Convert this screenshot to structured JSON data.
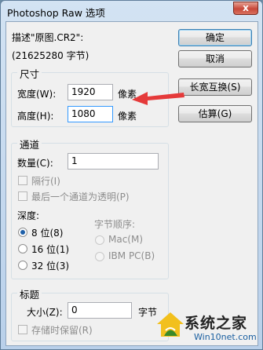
{
  "window": {
    "title": "Photoshop Raw 选项",
    "close_glyph": "x"
  },
  "description": {
    "label": "描述\"原图.CR2\":",
    "bytes": "(21625280 字节)"
  },
  "size_group": {
    "title": "尺寸",
    "width_label": "宽度(W):",
    "width_value": "1920",
    "width_unit": "像素",
    "height_label": "高度(H):",
    "height_value": "1080",
    "height_unit": "像素"
  },
  "buttons": {
    "ok": "确定",
    "cancel": "取消",
    "swap": "长宽互换(S)",
    "guess": "估算(G)"
  },
  "channels_group": {
    "title": "通道",
    "count_label": "数量(C):",
    "count_value": "1",
    "interleaved_label": "隔行(I)",
    "last_transparent_label": "最后一个通道为透明(P)",
    "depth_label": "深度:",
    "depth_options": [
      "8 位(8)",
      "16 位(1)",
      "32 位(3)"
    ],
    "byte_order_label": "字节顺序:",
    "byte_order_options": [
      "Mac(M)",
      "IBM PC(B)"
    ]
  },
  "header_group": {
    "title": "标题",
    "size_label": "大小(Z):",
    "size_value": "0",
    "size_unit": "字节",
    "keep_label": "存储时保留(R)"
  },
  "watermark": {
    "brand": "系统之家",
    "site": "Win10net.com"
  },
  "colors": {
    "annotation_arrow": "#e53a3a",
    "accent_focus": "#3399ff"
  }
}
